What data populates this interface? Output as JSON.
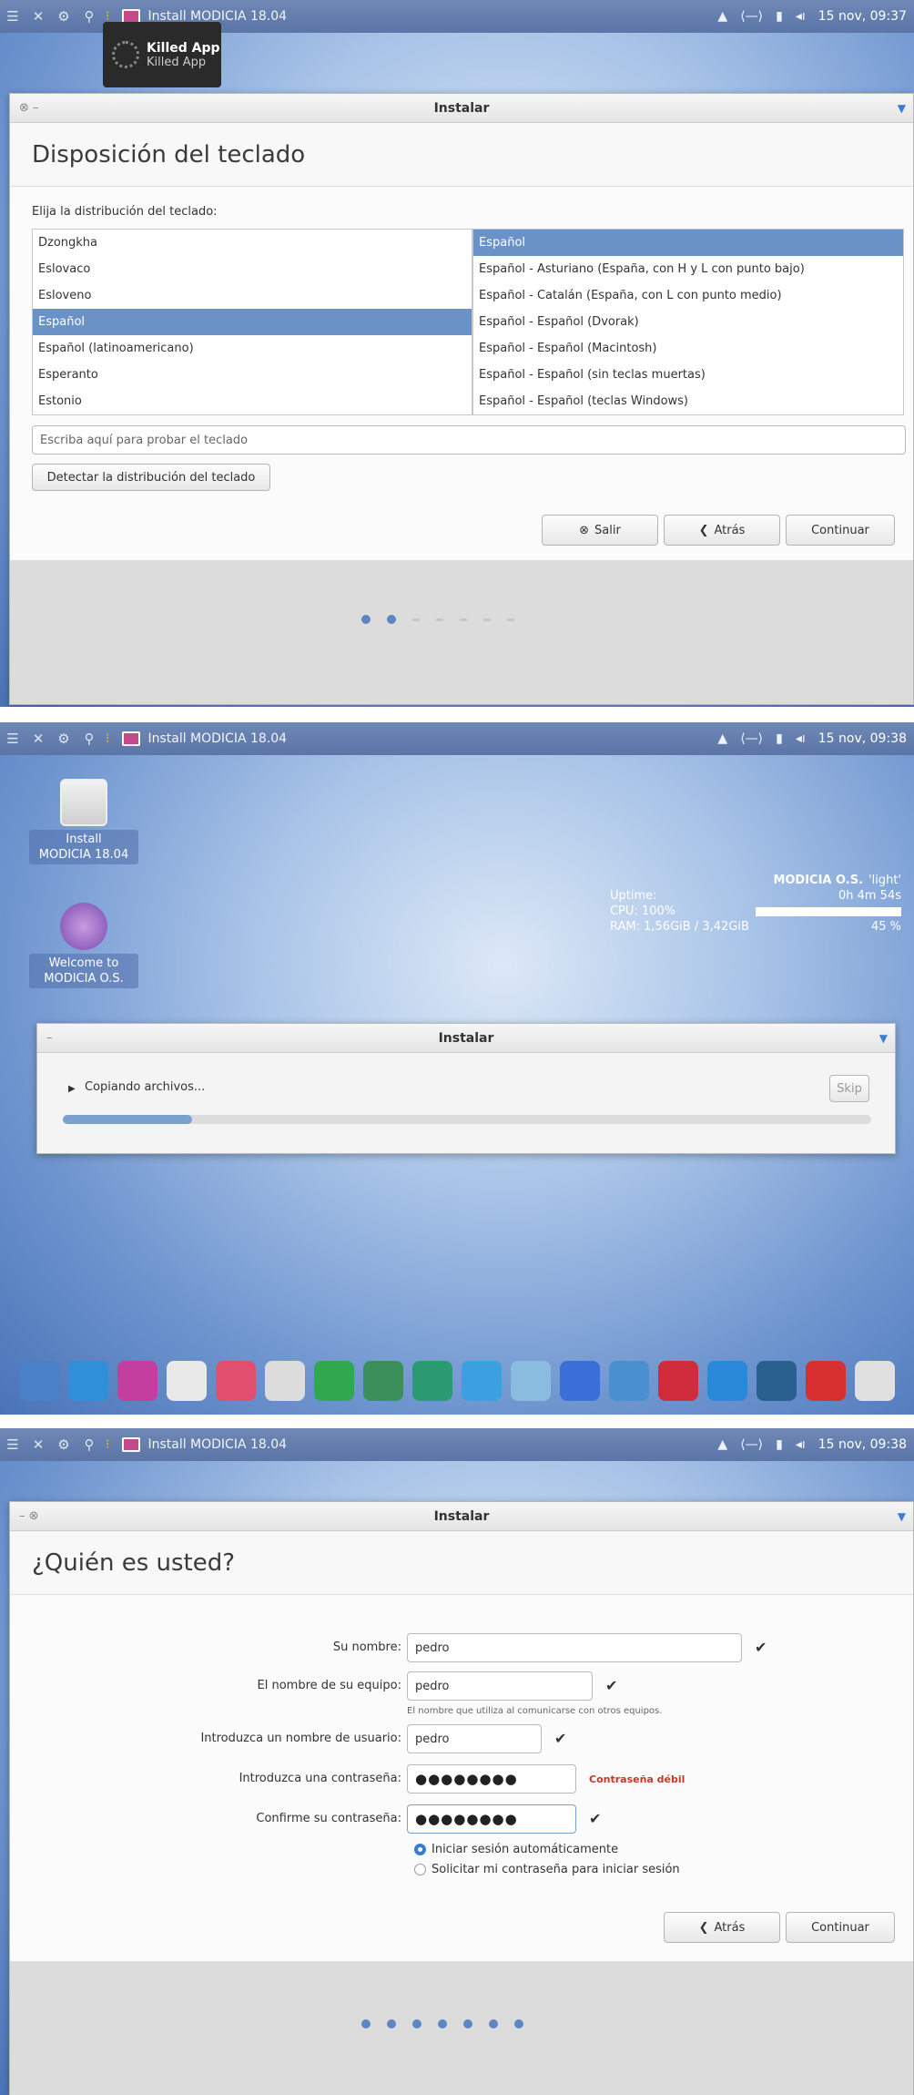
{
  "system_bar": {
    "app_title": "Install MODICIA 18.04",
    "shot1_clock": "15 nov, 09:37",
    "shot2_clock": "15 nov, 09:38",
    "shot3_clock": "15 nov, 09:38"
  },
  "notification": {
    "title": "Killed App",
    "body": "Killed App"
  },
  "installer": {
    "window_title": "Instalar"
  },
  "keyboard_step": {
    "heading": "Disposición del teclado",
    "prompt": "Elija la distribución del teclado:",
    "layouts": [
      "Dzongkha",
      "Eslovaco",
      "Esloveno",
      "Español",
      "Español (latinoamericano)",
      "Esperanto",
      "Estonio"
    ],
    "selected_layout_index": 3,
    "variants": [
      "Español",
      "Español - Asturiano (España, con H y L con punto bajo)",
      "Español - Catalán (España, con L con punto medio)",
      "Español - Español (Dvorak)",
      "Español - Español (Macintosh)",
      "Español - Español (sin teclas muertas)",
      "Español - Español (teclas Windows)"
    ],
    "selected_variant_index": 0,
    "test_placeholder": "Escriba aquí para probar el teclado",
    "detect_button": "Detectar la distribución del teclado",
    "quit_button": "Salir",
    "back_button": "Atrás",
    "continue_button": "Continuar"
  },
  "desktop": {
    "icons": [
      {
        "label_line1": "Install",
        "label_line2": "MODICIA 18.04"
      },
      {
        "label_line1": "Welcome to",
        "label_line2": "MODICIA O.S."
      }
    ],
    "conky": {
      "brand": "MODICIA O.S.",
      "edition": "'light'",
      "uptime_label": "Uptime:",
      "uptime_value": "0h 4m 54s",
      "cpu_label": "CPU: 100%",
      "ram_label": "RAM: 1,56GiB / 3,42GiB",
      "ram_percent": "45 %",
      "cpu_level": 1.0
    },
    "dock_apps": [
      "files-icon",
      "settings-icon",
      "app-store-icon",
      "text-editor-icon",
      "screenshot-icon",
      "printer-icon",
      "trash-green-icon",
      "monitor-icon",
      "browser-icon",
      "telegram-icon",
      "video-icon",
      "firefox-icon",
      "photos-icon",
      "media-player-icon",
      "music-icon",
      "notes-icon",
      "pdf-icon",
      "trash-icon"
    ]
  },
  "copy_step": {
    "status": "Copiando archivos...",
    "skip_button": "Skip",
    "progress": 0.16
  },
  "user_step": {
    "heading": "¿Quién es usted?",
    "name_label": "Su nombre:",
    "name_value": "pedro",
    "computer_label": "El nombre de su equipo:",
    "computer_value": "pedro",
    "computer_hint": "El nombre que utiliza al comunicarse con otros equipos.",
    "username_label": "Introduzca un nombre de usuario:",
    "username_value": "pedro",
    "password_label": "Introduzca una contraseña:",
    "password_mask": "●●●●●●●●",
    "password_strength": "Contraseña débil",
    "confirm_label": "Confirme su contraseña:",
    "confirm_mask": "●●●●●●●●",
    "auto_login": "Iniciar sesión automáticamente",
    "require_password": "Solicitar mi contraseña para iniciar sesión",
    "back_button": "Atrás",
    "continue_button": "Continuar"
  },
  "colors": {
    "accent": "#6a92c6",
    "weak_password": "#c0392b",
    "desktop": "#6f95cf"
  }
}
